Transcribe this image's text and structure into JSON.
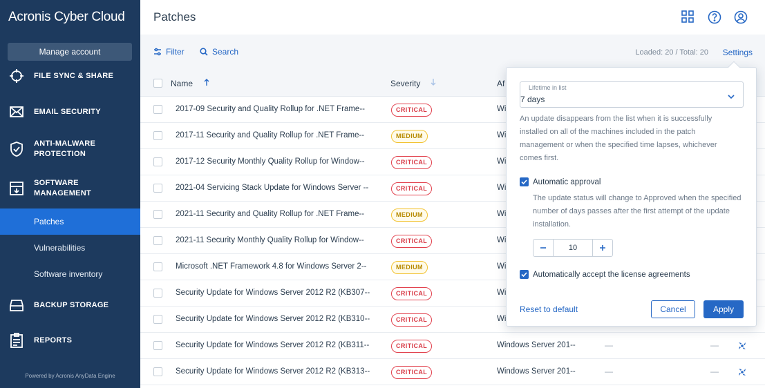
{
  "app": {
    "brand": "Acronis Cyber Cloud",
    "manage_account": "Manage account",
    "powered_by": "Powered by Acronis AnyData Engine"
  },
  "nav": {
    "file_sync": "FILE SYNC & SHARE",
    "email_security": "EMAIL SECURITY",
    "anti_malware_1": "ANTI-MALWARE",
    "anti_malware_2": "PROTECTION",
    "software_mgmt_1": "SOFTWARE",
    "software_mgmt_2": "MANAGEMENT",
    "sub": [
      "Patches",
      "Vulnerabilities",
      "Software inventory"
    ],
    "active_sub": "Patches",
    "backup_storage": "BACKUP STORAGE",
    "reports": "REPORTS"
  },
  "header": {
    "title": "Patches",
    "icons": [
      "grid-icon",
      "help-icon",
      "account-icon"
    ]
  },
  "toolbar": {
    "filter": "Filter",
    "search": "Search",
    "loaded": "Loaded: 20 / Total: 20",
    "settings": "Settings"
  },
  "table": {
    "columns": {
      "name": "Name",
      "severity": "Severity",
      "affected": "Af"
    },
    "rows": [
      {
        "name": "2017-09 Security and Quality Rollup for .NET Frame--",
        "severity": "CRITICAL",
        "affected": "Wi"
      },
      {
        "name": "2017-11 Security and Quality Rollup for .NET Frame--",
        "severity": "MEDIUM",
        "affected": "Wi"
      },
      {
        "name": "2017-12 Security Monthly Quality Rollup for Window--",
        "severity": "CRITICAL",
        "affected": "Wi"
      },
      {
        "name": "2021-04 Servicing Stack Update for Windows Server --",
        "severity": "CRITICAL",
        "affected": "Wi"
      },
      {
        "name": "2021-11 Security and Quality Rollup for .NET Frame--",
        "severity": "MEDIUM",
        "affected": "Wi"
      },
      {
        "name": "2021-11 Security Monthly Quality Rollup for Window--",
        "severity": "CRITICAL",
        "affected": "Wi"
      },
      {
        "name": "Microsoft .NET Framework 4.8 for Windows Server 2--",
        "severity": "MEDIUM",
        "affected": "Wi"
      },
      {
        "name": "Security Update for Windows Server 2012 R2 (KB307--",
        "severity": "CRITICAL",
        "affected": "Wi"
      },
      {
        "name": "Security Update for Windows Server 2012 R2 (KB310--",
        "severity": "CRITICAL",
        "affected": "Wi"
      },
      {
        "name": "Security Update for Windows Server 2012 R2 (KB311--",
        "severity": "CRITICAL",
        "affected": "Windows Server 201--",
        "d1": "—",
        "d2": "—"
      },
      {
        "name": "Security Update for Windows Server 2012 R2 (KB313--",
        "severity": "CRITICAL",
        "affected": "Windows Server 201--",
        "d1": "—",
        "d2": "—"
      }
    ]
  },
  "settings_popover": {
    "lifetime_label": "Lifetime in list",
    "lifetime_value": "7 days",
    "lifetime_desc": "An update disappears from the list when it is successfully installed on all of the machines included in the patch management or when the specified time lapses, whichever comes first.",
    "auto_approval_label": "Automatic approval",
    "auto_approval_checked": true,
    "auto_approval_desc": "The update status will change to Approved when the specified number of days passes after the first attempt of the update installation.",
    "days_value": "10",
    "accept_license_label": "Automatically accept the license agreements",
    "accept_license_checked": true,
    "reset": "Reset to default",
    "cancel": "Cancel",
    "apply": "Apply"
  },
  "colors": {
    "sidebar": "#1d3a5e",
    "active": "#1f6fd8",
    "accent": "#2668c5",
    "critical": "#e2414d",
    "medium": "#f2c230"
  }
}
